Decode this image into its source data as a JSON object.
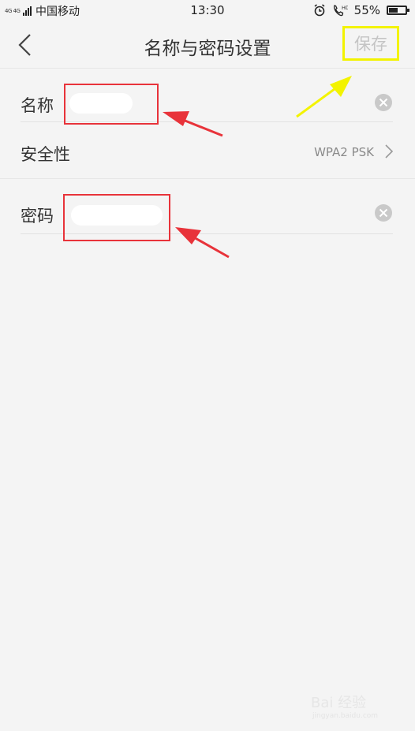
{
  "status_bar": {
    "network": "4G 4G",
    "carrier": "中国移动",
    "time": "13:30",
    "battery_percent": "55%",
    "battery_level": 0.55
  },
  "nav": {
    "title": "名称与密码设置",
    "save_label": "保存"
  },
  "form": {
    "name_label": "名称",
    "security_label": "安全性",
    "security_value": "WPA2 PSK",
    "password_label": "密码"
  },
  "icons": {
    "back": "chevron-left-icon",
    "clear": "clear-icon",
    "chevron": "chevron-right-icon",
    "alarm": "alarm-icon",
    "call": "hd-call-icon"
  },
  "colors": {
    "background": "#f4f4f4",
    "highlight_red": "#e8333a",
    "highlight_yellow": "#f3f300"
  },
  "watermark": {
    "text": "Bai 经验",
    "url": "jingyan.baidu.com"
  }
}
